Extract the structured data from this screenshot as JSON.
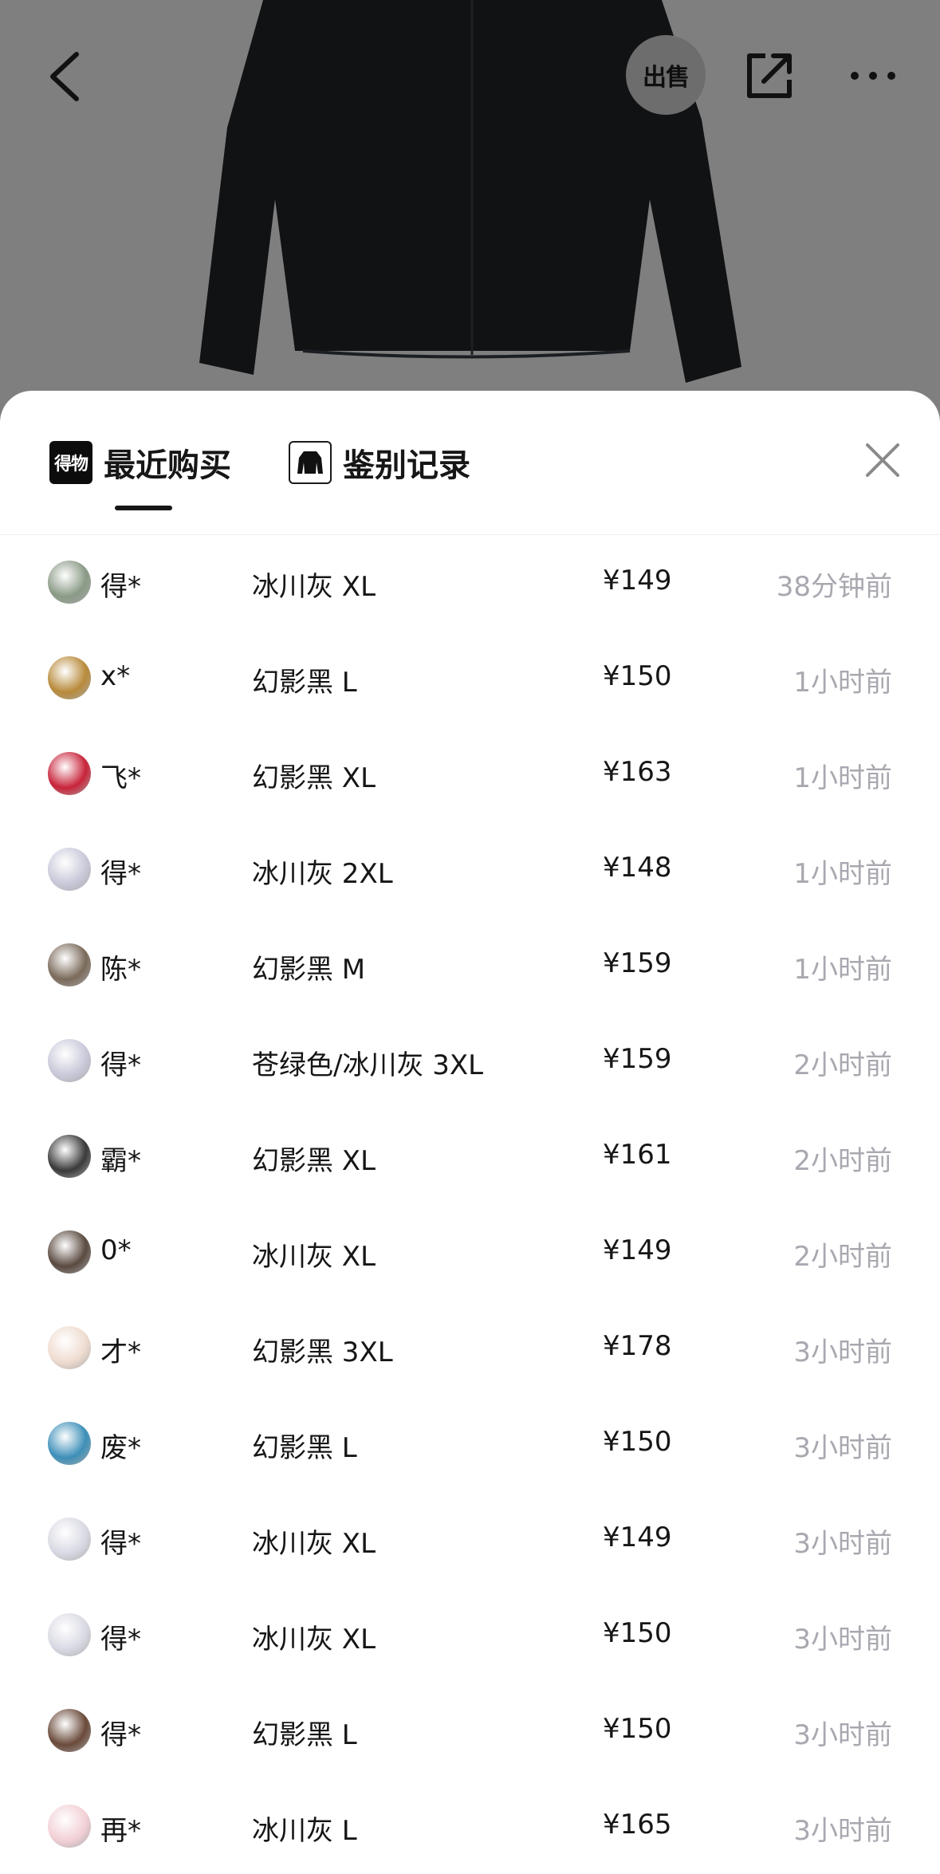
{
  "top_bar": {
    "sell_label": "出售"
  },
  "tabs": [
    {
      "icon_text": "得物",
      "label": "最近购买",
      "active": true
    },
    {
      "label": "鉴别记录",
      "active": false
    }
  ],
  "colors": {
    "background_dim": "#808080",
    "text_primary": "#161616",
    "text_muted": "#a8a8b0"
  },
  "purchases": [
    {
      "user": "得*",
      "spec": "冰川灰 XL",
      "price": "¥149",
      "time": "38分钟前",
      "avatar_color": "#8a9a86"
    },
    {
      "user": "x*",
      "spec": "幻影黑 L",
      "price": "¥150",
      "time": "1小时前",
      "avatar_color": "#b88a3a"
    },
    {
      "user": "飞*",
      "spec": "幻影黑 XL",
      "price": "¥163",
      "time": "1小时前",
      "avatar_color": "#c8243a"
    },
    {
      "user": "得*",
      "spec": "冰川灰 2XL",
      "price": "¥148",
      "time": "1小时前",
      "avatar_color": "#c9c9da"
    },
    {
      "user": "陈*",
      "spec": "幻影黑 M",
      "price": "¥159",
      "time": "1小时前",
      "avatar_color": "#7a6a5a"
    },
    {
      "user": "得*",
      "spec": "苍绿色/冰川灰 3XL",
      "price": "¥159",
      "time": "2小时前",
      "avatar_color": "#c9c9da"
    },
    {
      "user": "霸*",
      "spec": "幻影黑 XL",
      "price": "¥161",
      "time": "2小时前",
      "avatar_color": "#3a3a3a"
    },
    {
      "user": "0*",
      "spec": "冰川灰 XL",
      "price": "¥149",
      "time": "2小时前",
      "avatar_color": "#5a4a40"
    },
    {
      "user": "才*",
      "spec": "幻影黑 3XL",
      "price": "¥178",
      "time": "3小时前",
      "avatar_color": "#efdcd0"
    },
    {
      "user": "废*",
      "spec": "幻影黑 L",
      "price": "¥150",
      "time": "3小时前",
      "avatar_color": "#3d8fb8"
    },
    {
      "user": "得*",
      "spec": "冰川灰 XL",
      "price": "¥149",
      "time": "3小时前",
      "avatar_color": "#d9d9e4"
    },
    {
      "user": "得*",
      "spec": "冰川灰 XL",
      "price": "¥150",
      "time": "3小时前",
      "avatar_color": "#d9d9e4"
    },
    {
      "user": "得*",
      "spec": "幻影黑 L",
      "price": "¥150",
      "time": "3小时前",
      "avatar_color": "#6a4a3a"
    },
    {
      "user": "再*",
      "spec": "冰川灰 L",
      "price": "¥165",
      "time": "3小时前",
      "avatar_color": "#f2d0d6"
    }
  ]
}
